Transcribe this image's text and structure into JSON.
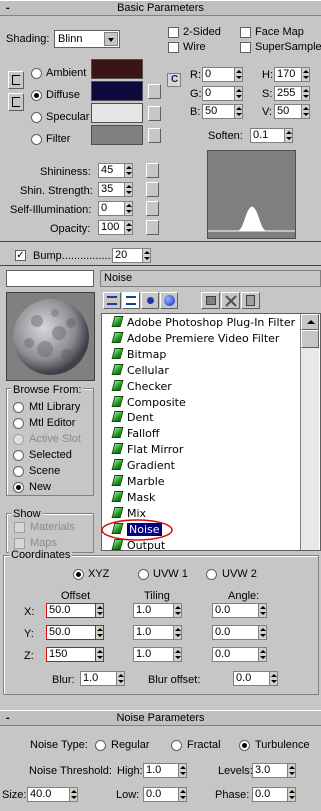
{
  "basic_parameters": {
    "title": "Basic Parameters",
    "collapse_symbol": "-",
    "shading_label": "Shading:",
    "shading_value": "Blinn",
    "two_sided": "2-Sided",
    "wire": "Wire",
    "face_map": "Face Map",
    "supersample": "SuperSample",
    "ambient": "Ambient",
    "diffuse": "Diffuse",
    "specular": "Specular",
    "filter": "Filter",
    "colors": {
      "ambient": "#3c1414",
      "diffuse": "#0a0a3c",
      "specular": "#e6e6e6",
      "filter": "#808080"
    },
    "lock_symbol": "C",
    "r_label": "R:",
    "r_value": "0",
    "g_label": "G:",
    "g_value": "0",
    "b_label": "B:",
    "b_value": "50",
    "h_label": "H:",
    "h_value": "170",
    "s_label": "S:",
    "s_value": "255",
    "v_label": "V:",
    "v_value": "50",
    "soften_label": "Soften:",
    "soften_value": "0.1",
    "shininess_label": "Shininess:",
    "shininess_value": "45",
    "shin_strength_label": "Shin. Strength:",
    "shin_strength_value": "35",
    "self_illum_label": "Self-Illumination:",
    "self_illum_value": "0",
    "opacity_label": "Opacity:",
    "opacity_value": "100"
  },
  "bump": {
    "checkbox_mark": "✓",
    "label": "Bump..................",
    "value": "20"
  },
  "browser": {
    "name_field": "",
    "type_label": "Noise",
    "browse_from_title": "Browse From:",
    "browse_from": [
      "Mtl Library",
      "Mtl Editor",
      "Active Slot",
      "Selected",
      "Scene",
      "New"
    ],
    "show_title": "Show",
    "show_options": [
      "Materials",
      "Maps"
    ],
    "list_items": [
      "Adobe Photoshop Plug-In Filter",
      "Adobe Premiere Video Filter",
      "Bitmap",
      "Cellular",
      "Checker",
      "Composite",
      "Dent",
      "Falloff",
      "Flat Mirror",
      "Gradient",
      "Marble",
      "Mask",
      "Mix",
      "Noise",
      "Output"
    ],
    "selected_item": "Noise"
  },
  "coordinates": {
    "title": "Coordinates",
    "xyz": "XYZ",
    "uvw1": "UVW 1",
    "uvw2": "UVW 2",
    "offset_label": "Offset",
    "tiling_label": "Tiling",
    "angle_label": "Angle:",
    "x_label": "X:",
    "y_label": "Y:",
    "z_label": "Z:",
    "offset": [
      "50.0",
      "50.0",
      "150"
    ],
    "tiling": [
      "1.0",
      "1.0",
      "1.0"
    ],
    "angle": [
      "0.0",
      "0.0",
      "0.0"
    ],
    "blur_label": "Blur:",
    "blur_value": "1.0",
    "blur_offset_label": "Blur offset:",
    "blur_offset_value": "0.0"
  },
  "noise_parameters": {
    "title": "Noise Parameters",
    "collapse_symbol": "-",
    "noise_type_label": "Noise Type:",
    "regular": "Regular",
    "fractal": "Fractal",
    "turbulence": "Turbulence",
    "threshold_label": "Noise Threshold:",
    "high_label": "High:",
    "high_value": "1.0",
    "levels_label": "Levels:",
    "levels_value": "3.0",
    "size_label": "Size:",
    "size_value": "40.0",
    "low_label": "Low:",
    "low_value": "0.0",
    "phase_label": "Phase:",
    "phase_value": "0.0"
  }
}
